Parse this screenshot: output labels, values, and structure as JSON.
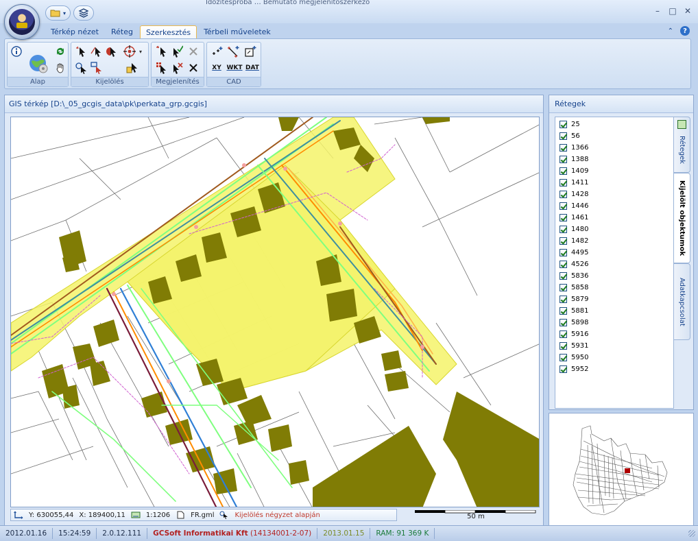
{
  "title_partial": "Időzítésproba  …  Bemutató megjelenítőszerkező",
  "quick_access": {
    "open_label": "",
    "layers_label": ""
  },
  "window_controls": {
    "minimize": "–",
    "maximize": "□",
    "close": "✕"
  },
  "tabs": [
    {
      "label": "Térkép nézet",
      "active": false
    },
    {
      "label": "Réteg",
      "active": false
    },
    {
      "label": "Szerkesztés",
      "active": true
    },
    {
      "label": "Térbeli műveletek",
      "active": false
    }
  ],
  "ribbon": {
    "groups": [
      {
        "label": "Alap"
      },
      {
        "label": "Kijelölés"
      },
      {
        "label": "Megjelenítés"
      },
      {
        "label": "CAD"
      }
    ],
    "cad_buttons": {
      "xy": "XY",
      "wkt": "WKT",
      "dat": "DAT"
    }
  },
  "map": {
    "header": "GIS térkép [D:\\_05_gcgis_data\\pk\\perkata_grp.gcgis]",
    "coord_y": "Y: 630055,44",
    "coord_x": "X: 189400,11",
    "scale": "1:1206",
    "file": "FR.gml",
    "mode": "Kijelölés négyzet alapján",
    "scalebar_label": "50 m"
  },
  "layers": {
    "header": "Rétegek",
    "items": [
      "25",
      "56",
      "1366",
      "1388",
      "1409",
      "1411",
      "1428",
      "1446",
      "1461",
      "1480",
      "1482",
      "4495",
      "4526",
      "5836",
      "5858",
      "5879",
      "5881",
      "5898",
      "5916",
      "5931",
      "5950",
      "5952"
    ],
    "side_tabs": {
      "layers": "Rétegek",
      "selected": "Kijelölt objektumok",
      "connection": "Adatkapcsolat"
    }
  },
  "status": {
    "date": "2012.01.16",
    "time": "15:24:59",
    "version": "2.0.12.111",
    "company": "GCSoft Informatikai Kft",
    "company_id": "(14134001-2-07)",
    "license_date": "2013.01.15",
    "ram": "RAM: 91 369 K"
  },
  "colors": {
    "selection_fill": "#f4f36a",
    "building": "#807c05",
    "parcel_line": "#6e6e6e",
    "gas_line": "#a05a1e",
    "water_line": "#2f7fd6",
    "sewer_line": "#7a1d3a",
    "power_line": "#ff8c00",
    "telecom_line": "#7fff7f"
  }
}
